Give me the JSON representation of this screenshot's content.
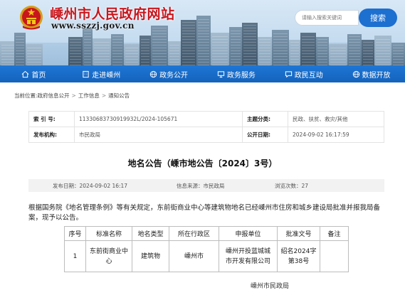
{
  "header": {
    "site_title": "嵊州市人民政府网站",
    "site_url": "www.sszzj.gov.cn",
    "search_placeholder": "请输入搜索关键词",
    "search_button": "搜索"
  },
  "nav": {
    "items": [
      {
        "label": "首页",
        "icon": "home-icon"
      },
      {
        "label": "走进嵊州",
        "icon": "building-icon"
      },
      {
        "label": "政务公开",
        "icon": "globe-icon"
      },
      {
        "label": "政务服务",
        "icon": "monitor-icon"
      },
      {
        "label": "政民互动",
        "icon": "chat-icon"
      },
      {
        "label": "数据开放",
        "icon": "globe-icon"
      }
    ]
  },
  "breadcrumb": {
    "prefix": "当前位置:",
    "items": [
      "政府信息公开",
      "工作信息",
      "通知公告"
    ],
    "separator": ">"
  },
  "meta": {
    "index_label": "索 引 号:",
    "index_value": "11330683730919932L/2024-105671",
    "topic_label": "主题分类:",
    "topic_value": "民政、扶贫、救灾/其他",
    "org_label": "发布机构:",
    "org_value": "市民政局",
    "date_label": "公开日期:",
    "date_value": "2024-09-02 16:17:59"
  },
  "article": {
    "title": "地名公告（嵊市地公告〔2024〕3号）",
    "publish_time": "发布日期：2024-09-02 16:17",
    "source": "信息来源：市民政局",
    "views": "浏览次数：27",
    "body_line1": "根据国务院《地名管理条例》等有关规定，东前街商业中心等建筑物地名已经嵊州市住房和城乡建设局批准并报我局备",
    "body_line2": "案，现予以公告。",
    "table": {
      "headers": [
        "序号",
        "标准名称",
        "地名类型",
        "所在行政区",
        "申报单位",
        "批准文号",
        "备注"
      ],
      "row": {
        "no": "1",
        "name_l1": "东前街商业中",
        "name_l2": "心",
        "type": "建筑物",
        "district": "嵊州市",
        "applicant_l1": "嵊州开投蓝城城",
        "applicant_l2": "市开发有限公司",
        "approval_l1": "绍名2024字",
        "approval_l2": "第38号",
        "remark": ""
      }
    },
    "signature": "嵊州市民政局"
  },
  "colors": {
    "brand_red": "#c8161d",
    "nav_blue": "#1a6cc9",
    "button_blue": "#1d6fd0"
  }
}
